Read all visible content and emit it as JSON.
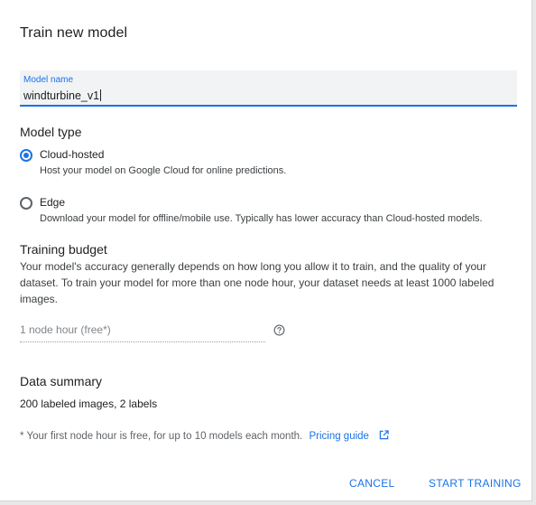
{
  "dialog": {
    "title": "Train new model"
  },
  "model_name": {
    "label": "Model name",
    "value": "windturbine_v1"
  },
  "model_type": {
    "title": "Model type",
    "selected": "cloud-hosted",
    "options": [
      {
        "label": "Cloud-hosted",
        "description": "Host your model on Google Cloud for online predictions."
      },
      {
        "label": "Edge",
        "description": "Download your model for offline/mobile use. Typically has lower accuracy than Cloud-hosted models."
      }
    ]
  },
  "training_budget": {
    "title": "Training budget",
    "description": "Your model's accuracy generally depends on how long you allow it to train, and the quality of your dataset. To train your model for more than one node hour, your dataset needs at least 1000 labeled images.",
    "placeholder": "1 node hour (free*)",
    "help_icon": "help-circle-icon"
  },
  "data_summary": {
    "title": "Data summary",
    "text": "200 labeled images, 2 labels"
  },
  "footnote": {
    "text": "* Your first node hour is free, for up to 10 models each month.",
    "link": "Pricing guide",
    "link_icon": "external-link-icon"
  },
  "actions": {
    "cancel": "CANCEL",
    "start": "START TRAINING"
  },
  "colors": {
    "accent": "#1a73e8",
    "text": "#202124",
    "field_bg": "#f1f3f4"
  }
}
